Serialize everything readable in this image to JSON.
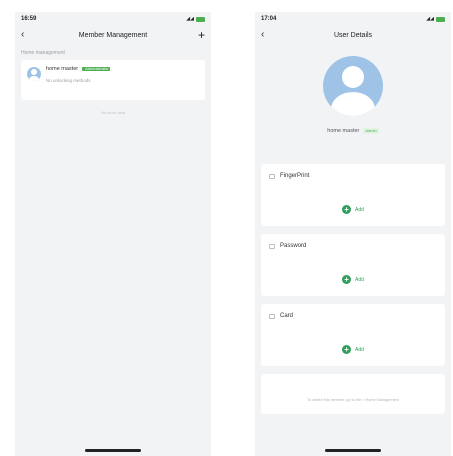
{
  "left_screen": {
    "status_time": "16:59",
    "signal": "◢◢",
    "title": "Member Management",
    "section_caption": "Home management",
    "member": {
      "name": "home master",
      "badge": "Administrator",
      "sub": "No unlocking methods"
    },
    "footer": "No more data"
  },
  "right_screen": {
    "status_time": "17:04",
    "signal": "◢◢",
    "title": "User Details",
    "profile": {
      "name": "home master",
      "badge": "Admin"
    },
    "credentials": [
      {
        "title": "FingerPrint",
        "add_label": "Add"
      },
      {
        "title": "Password",
        "add_label": "Add"
      },
      {
        "title": "Card",
        "add_label": "Add"
      }
    ],
    "bottom_note": "To delete this member, go to the > Home Management"
  },
  "colors": {
    "accent_green": "#2e9e5b",
    "avatar_blue": "#9ec3e6",
    "background": "#f2f3f5"
  },
  "icons": {
    "back": "chevron-left-icon",
    "add": "plus-icon",
    "credential": "credential-icon",
    "add_circle": "plus-circle-icon"
  }
}
